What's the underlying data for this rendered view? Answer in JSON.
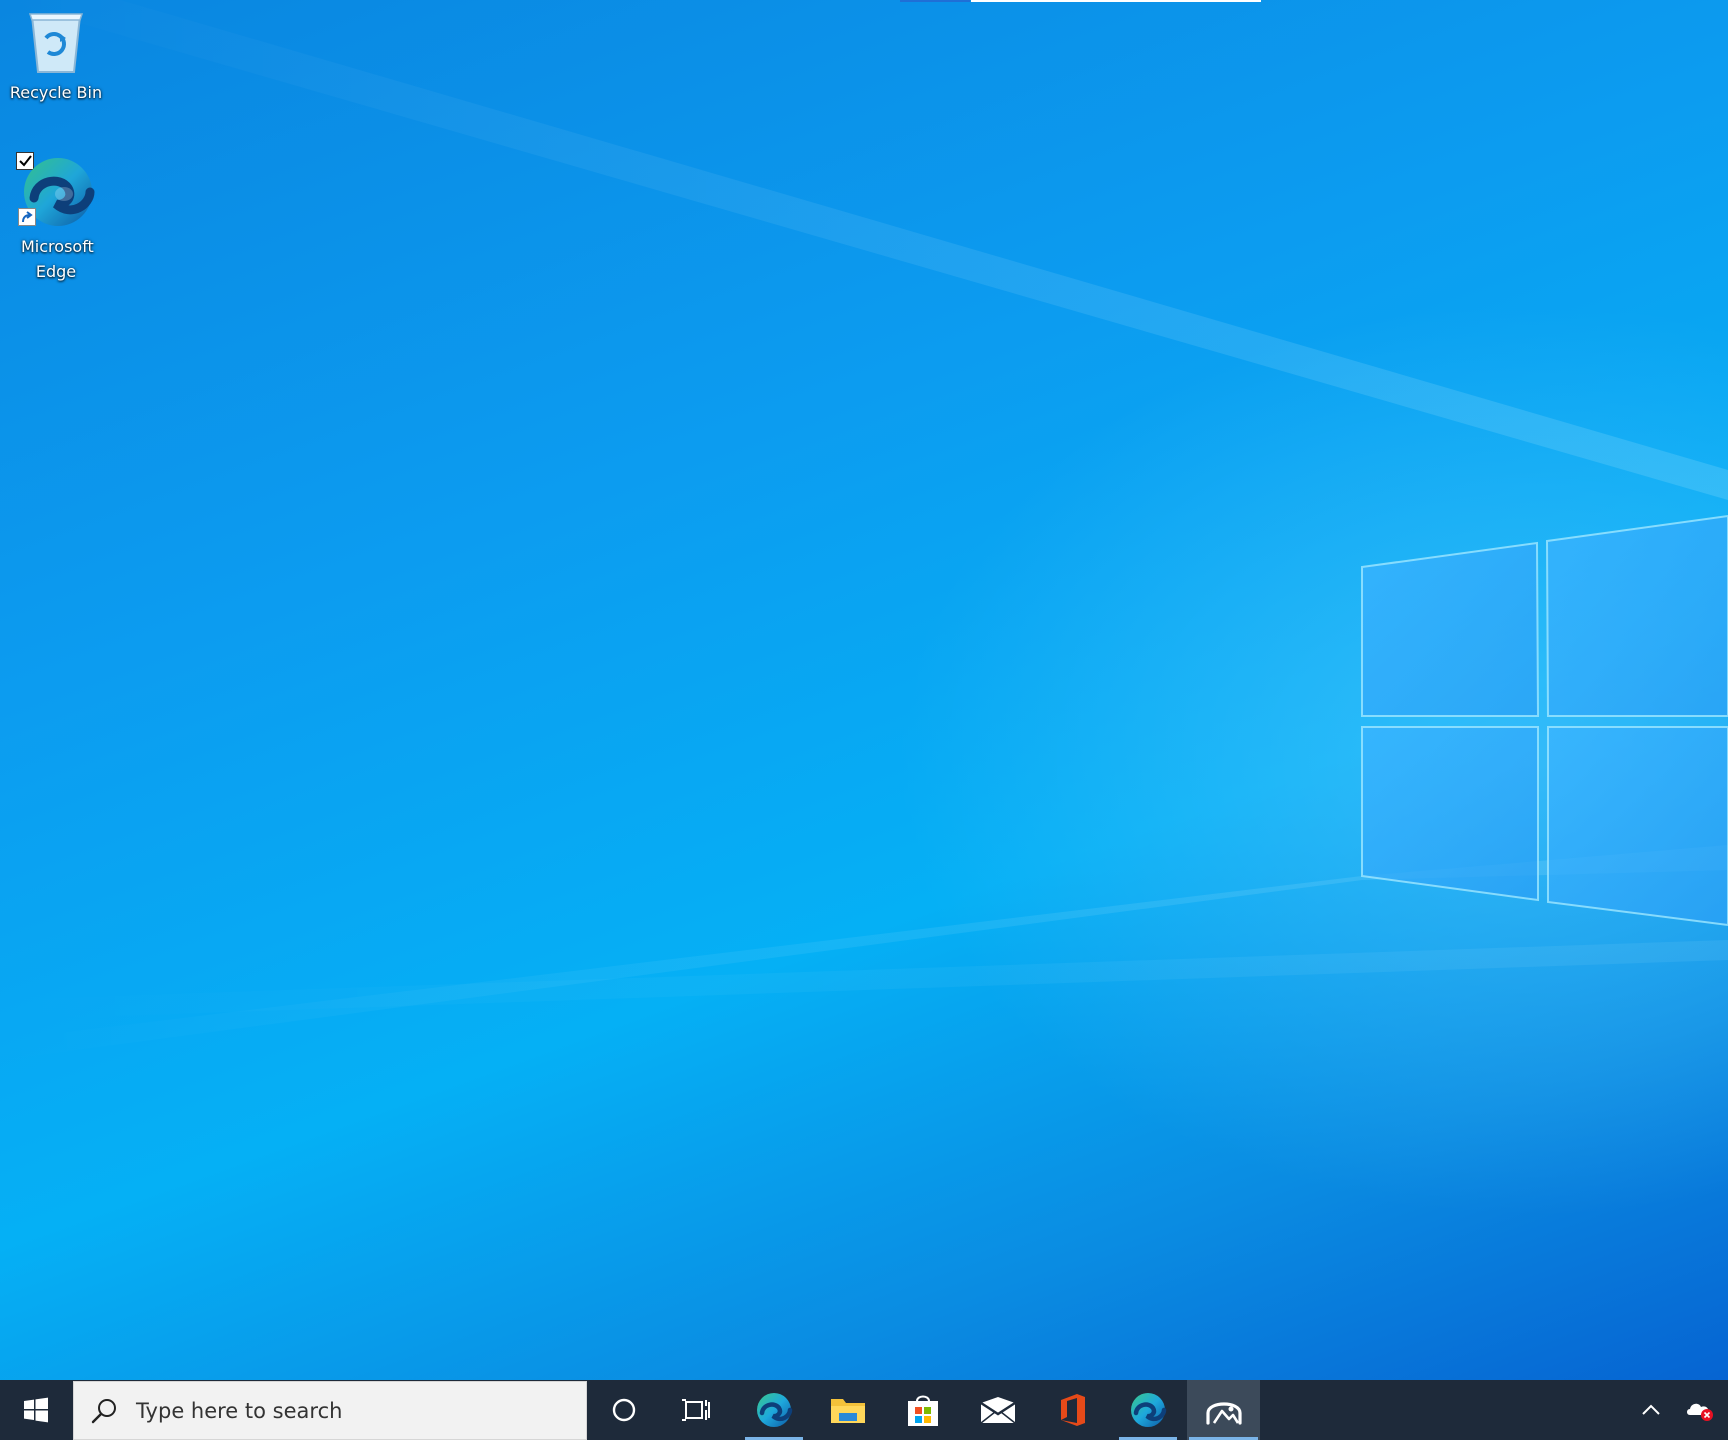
{
  "desktop": {
    "icons": [
      {
        "label": "Recycle Bin"
      },
      {
        "label": "Microsoft Edge"
      }
    ]
  },
  "taskbar": {
    "search": {
      "placeholder": "Type here to search"
    },
    "apps": [
      {
        "name": "start-icon"
      },
      {
        "name": "cortana-icon"
      },
      {
        "name": "task-view-icon"
      },
      {
        "name": "edge-icon"
      },
      {
        "name": "file-explorer-icon"
      },
      {
        "name": "store-icon"
      },
      {
        "name": "mail-icon"
      },
      {
        "name": "office-icon"
      },
      {
        "name": "edge-icon"
      },
      {
        "name": "photos-icon"
      }
    ],
    "tray": [
      {
        "name": "show-hidden-icons-chevron"
      },
      {
        "name": "onedrive-error-icon"
      }
    ]
  },
  "colors": {
    "taskbar": "#1e2a3a",
    "desktop_accent": "#0a9cf0"
  }
}
